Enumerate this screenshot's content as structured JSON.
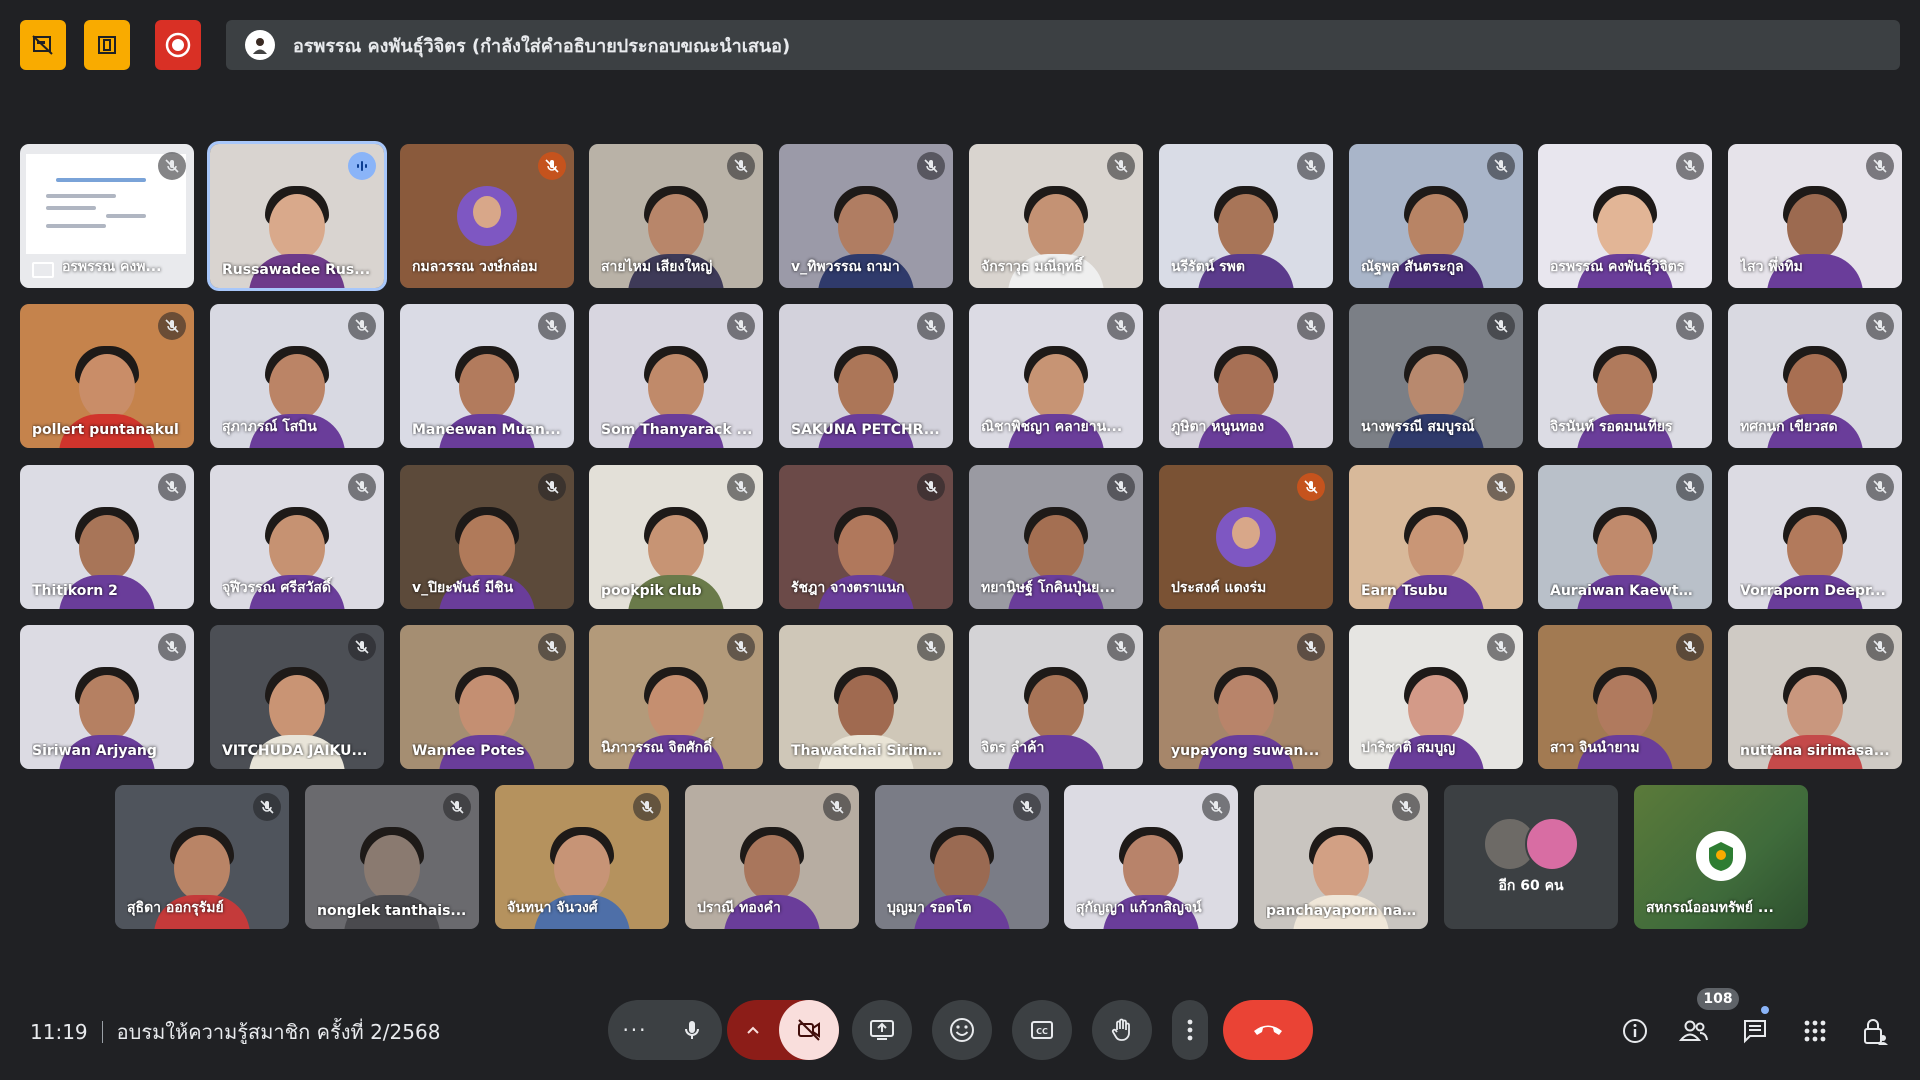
{
  "banner": {
    "text": "อรพรรณ คงพันธุ์วิจิตร (กำลังใส่คำอธิบายประกอบขณะนำเสนอ)"
  },
  "top_buttons": [
    "no-video-layout-icon",
    "pin-layout-icon",
    "record-icon"
  ],
  "participants": [
    {
      "name": "อรพรรณ คงพ...",
      "type": "presenting",
      "mic": "muted"
    },
    {
      "name": "Russawadee Rus...",
      "type": "video",
      "mic": "speaking",
      "speaking": true,
      "bg": "#d9d4d0",
      "shirt": "#6e3a8a",
      "skin": "#d9a98b"
    },
    {
      "name": "กมลวรรณ วงษ์กล่อม",
      "type": "avatar",
      "mic": "muted-orange",
      "bg": "#8a5a3c"
    },
    {
      "name": "สายไหม เสียงใหญ่",
      "type": "video",
      "mic": "muted",
      "bg": "#b9b2a7",
      "shirt": "#3e3a58",
      "skin": "#b8866a"
    },
    {
      "name": "v_ทิพวรรณ ถามา",
      "type": "video",
      "mic": "muted",
      "bg": "#9b9aa8",
      "shirt": "#2f3a6b",
      "skin": "#b07d62"
    },
    {
      "name": "จักราวุธ มณีฤทธิ์",
      "type": "video",
      "mic": "muted",
      "bg": "#d9d4cf",
      "shirt": "#efefef",
      "skin": "#c49274"
    },
    {
      "name": "นรีรัตน์ รพต",
      "type": "video",
      "mic": "muted",
      "bg": "#d9dce6",
      "shirt": "#5b3b8c",
      "skin": "#a87558"
    },
    {
      "name": "ณัฐพล สันตระกูล",
      "type": "video",
      "mic": "muted",
      "bg": "#a9b5c9",
      "shirt": "#4a2f78",
      "skin": "#b88465"
    },
    {
      "name": "อรพรรณ คงพันธุ์วิจิตร",
      "type": "video",
      "mic": "muted",
      "bg": "#e8e6ee",
      "shirt": "#6a3d9a",
      "skin": "#e2b596"
    },
    {
      "name": "ไสว พึ่งทิม",
      "type": "video",
      "mic": "muted",
      "bg": "#e6e3ea",
      "shirt": "#6a3d9a",
      "skin": "#9c6a50"
    },
    {
      "name": "pollert puntanakul",
      "type": "video",
      "mic": "muted",
      "bg": "#c5834c",
      "shirt": "#d0342c",
      "skin": "#c98d68"
    },
    {
      "name": "สุภาภรณ์ โสบิน",
      "type": "video",
      "mic": "muted",
      "bg": "#d8d9e2",
      "shirt": "#6a3d9a",
      "skin": "#bb8466"
    },
    {
      "name": "Maneewan Muan...",
      "type": "video",
      "mic": "muted",
      "bg": "#dadbe5",
      "shirt": "#6a3d9a",
      "skin": "#b27b5d"
    },
    {
      "name": "Som Thanyarack ...",
      "type": "video",
      "mic": "muted",
      "bg": "#d8d6e0",
      "shirt": "#6a3d9a",
      "skin": "#c08a6a"
    },
    {
      "name": "SAKUNA PETCHR...",
      "type": "video",
      "mic": "muted",
      "bg": "#d3d2dc",
      "shirt": "#6a3d9a",
      "skin": "#ac7658"
    },
    {
      "name": "ณิชาพิชญา คลายาน...",
      "type": "video",
      "mic": "muted",
      "bg": "#dcdbe4",
      "shirt": "#6a3d9a",
      "skin": "#c79474"
    },
    {
      "name": "ภูษิตา หนูนทอง",
      "type": "video",
      "mic": "muted",
      "bg": "#d5d2dc",
      "shirt": "#6a3d9a",
      "skin": "#a77055"
    },
    {
      "name": "นางพรรณี สมบูรณ์",
      "type": "video",
      "mic": "muted",
      "bg": "#7b7f86",
      "shirt": "#2f3a6b",
      "skin": "#b8896e"
    },
    {
      "name": "จิรนันท์ รอดมนเทียร",
      "type": "video",
      "mic": "muted",
      "bg": "#dcdce4",
      "shirt": "#6a3d9a",
      "skin": "#b07a5c"
    },
    {
      "name": "ทศกนก เขียวสด",
      "type": "video",
      "mic": "muted",
      "bg": "#d9d9e1",
      "shirt": "#6a3d9a",
      "skin": "#a86f52"
    },
    {
      "name": "Thitikorn 2",
      "type": "video",
      "mic": "muted",
      "bg": "#dcdce4",
      "shirt": "#6a3d9a",
      "skin": "#a87558"
    },
    {
      "name": "จุฬีวรรณ ศรีสวัสดิ์",
      "type": "video",
      "mic": "muted",
      "bg": "#dcdbe3",
      "shirt": "#6a3d9a",
      "skin": "#c69272"
    },
    {
      "name": "v_ปิยะพันธ์ มีชิน",
      "type": "video",
      "mic": "muted",
      "bg": "#5c4a3a",
      "shirt": "#6a3d9a",
      "skin": "#b07a5a"
    },
    {
      "name": "pookpik club",
      "type": "video",
      "mic": "muted",
      "bg": "#e3e0d8",
      "shirt": "#6a7a4a",
      "skin": "#c79474"
    },
    {
      "name": "รัชฎา จางตราแนก",
      "type": "video",
      "mic": "muted",
      "bg": "#6b4a48",
      "shirt": "#6a3d9a",
      "skin": "#b0785c"
    },
    {
      "name": "ทยานิษฐ์ โกคินปุ่นย...",
      "type": "video",
      "mic": "muted",
      "bg": "#9a9aa2",
      "shirt": "#6a3d9a",
      "skin": "#a46f52"
    },
    {
      "name": "ประสงค์ แดงร่ม",
      "type": "avatar",
      "mic": "muted-orange",
      "bg": "#7a5234"
    },
    {
      "name": "Earn Tsubu",
      "type": "video",
      "mic": "muted",
      "bg": "#d8b99a",
      "shirt": "#6a3d9a",
      "skin": "#c99676"
    },
    {
      "name": "Auraiwan Kaewta...",
      "type": "video",
      "mic": "muted",
      "bg": "#b9c0c9",
      "shirt": "#6a3d9a",
      "skin": "#c08a6c"
    },
    {
      "name": "Vorraporn Deepr...",
      "type": "video",
      "mic": "muted",
      "bg": "#dcdbe3",
      "shirt": "#6a3d9a",
      "skin": "#b27a5c"
    },
    {
      "name": "Siriwan Arjyang",
      "type": "video",
      "mic": "muted",
      "bg": "#dcdbe3",
      "shirt": "#6a3d9a",
      "skin": "#b58062"
    },
    {
      "name": "VITCHUDA JAIKU...",
      "type": "video",
      "mic": "muted",
      "bg": "#4c4f55",
      "shirt": "#e8e4d8",
      "skin": "#c99474"
    },
    {
      "name": "Wannee Potes",
      "type": "video",
      "mic": "muted",
      "bg": "#a58e72",
      "shirt": "#6a3d9a",
      "skin": "#c48f72"
    },
    {
      "name": "นิภาวรรณ จิตศักดิ์",
      "type": "video",
      "mic": "muted",
      "bg": "#b39a7a",
      "shirt": "#6a3d9a",
      "skin": "#c58f70"
    },
    {
      "name": "Thawatchai Sirim...",
      "type": "video",
      "mic": "muted",
      "bg": "#cfc7b8",
      "shirt": "#e9e4d6",
      "skin": "#a06a50"
    },
    {
      "name": "จิตร ลำค้า",
      "type": "video",
      "mic": "muted",
      "bg": "#d4d3d6",
      "shirt": "#6a3d9a",
      "skin": "#a87457"
    },
    {
      "name": "yupayong suwan...",
      "type": "video",
      "mic": "muted",
      "bg": "#a6866a",
      "shirt": "#6a3d9a",
      "skin": "#b8846a"
    },
    {
      "name": "ปาริชาติ สมบูญ",
      "type": "video",
      "mic": "muted",
      "bg": "#e6e5e2",
      "shirt": "#6a3d9a",
      "skin": "#d39a88"
    },
    {
      "name": "สาว จินนำยาม",
      "type": "video",
      "mic": "muted",
      "bg": "#a27a52",
      "shirt": "#6a3d9a",
      "skin": "#b07a5e"
    },
    {
      "name": "nuttana sirimasa...",
      "type": "video",
      "mic": "muted",
      "bg": "#cfcac4",
      "shirt": "#c44a4a",
      "skin": "#c9977e"
    },
    {
      "name": "สุธิดา ออกรุรัมย์",
      "type": "video",
      "mic": "muted",
      "bg": "#4f545c",
      "shirt": "#c43a3a",
      "skin": "#b98466"
    },
    {
      "name": "nonglek tanthais...",
      "type": "video",
      "mic": "muted",
      "bg": "#6a6a6e",
      "shirt": "#4a4a4e",
      "skin": "#8a7a70"
    },
    {
      "name": "จันทนา จันวงศ์",
      "type": "video",
      "mic": "muted",
      "bg": "#b5925e",
      "shirt": "#4e6fa8",
      "skin": "#c79476"
    },
    {
      "name": "ปราณี ทองคำ",
      "type": "video",
      "mic": "muted",
      "bg": "#b7ada2",
      "shirt": "#6a3d9a",
      "skin": "#a9765c"
    },
    {
      "name": "บุญมา รอดโต",
      "type": "video",
      "mic": "muted",
      "bg": "#7a7c86",
      "shirt": "#6a3d9a",
      "skin": "#9a6a52"
    },
    {
      "name": "สุกัญญา แก้วกสิญจน์",
      "type": "video",
      "mic": "muted",
      "bg": "#dcdbe3",
      "shirt": "#6a3d9a",
      "skin": "#b8836a"
    },
    {
      "name": "panchayaporn na...",
      "type": "video",
      "mic": "muted",
      "bg": "#c9c5c0",
      "shirt": "#efe6d8",
      "skin": "#d2a084"
    },
    {
      "name": "อีก 60 คน",
      "type": "more"
    },
    {
      "name": "สหกรณ์ออมทรัพย์ ...",
      "type": "coop"
    }
  ],
  "bottom": {
    "time": "11:19",
    "meeting_title": "อบรมให้ความรู้สมาชิก ครั้งที่ 2/2568",
    "people_count": "108"
  },
  "colors": {
    "background": "#202124",
    "tile": "#3c4043",
    "end_call": "#ea4335",
    "accent": "#8ab4f8",
    "speaking_ring": "#a8c7fa"
  }
}
